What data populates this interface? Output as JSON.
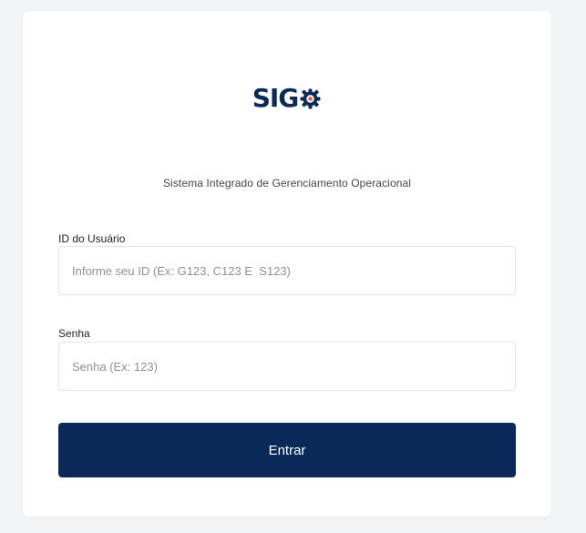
{
  "app": {
    "logo_text": "SIG",
    "logo_icon": "gear-icon",
    "subtitle": "Sistema Integrado de Gerenciamento Operacional"
  },
  "form": {
    "user_label": "ID do Usuário",
    "user_placeholder": "Informe seu ID (Ex: G123, C123 E  S123)",
    "password_label": "Senha",
    "password_placeholder": "Senha (Ex: 123)",
    "submit_label": "Entrar"
  },
  "colors": {
    "brand": "#0b2a55",
    "accent": "#e85a3c",
    "button_bg": "#0b2a5a",
    "page_bg": "#f1f3f4"
  }
}
